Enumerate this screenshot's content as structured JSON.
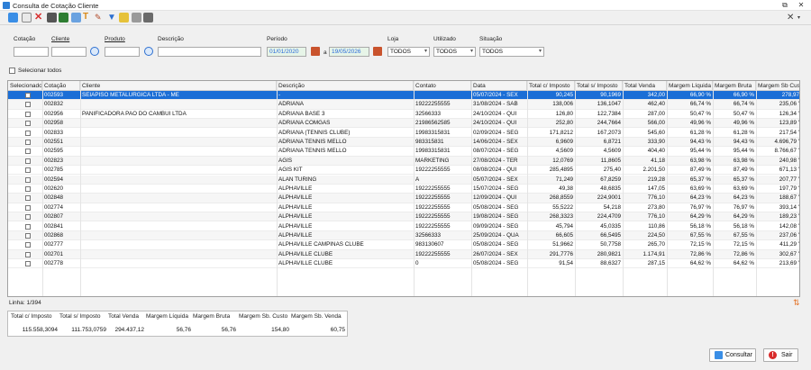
{
  "window": {
    "title": "Consulta de Cotação Cliente"
  },
  "filters": {
    "cotacao_label": "Cotação",
    "cliente_label": "Cliente",
    "produto_label": "Produto",
    "descricao_label": "Descrição",
    "periodo_label": "Período",
    "date_from": "01/01/2020",
    "a_label": "a",
    "date_to": "19/05/2026",
    "loja_label": "Loja",
    "loja_value": "TODOS",
    "utilizado_label": "Utilizado",
    "utilizado_value": "TODOS",
    "situacao_label": "Situação",
    "situacao_value": "TODOS",
    "select_all_label": "Selecionar todos"
  },
  "grid": {
    "headers": [
      "Selecionado",
      "Cotação",
      "Cliente",
      "Descrição",
      "Contato",
      "Data",
      "Total c/ Imposto",
      "Total s/ Imposto",
      "Total Venda",
      "Margem Líquida",
      "Margem Bruta",
      "Margem Sb Custo"
    ],
    "rows": [
      {
        "cot": "002593",
        "cli": "SEIAPISO METALURGICA LTDA - ME",
        "desc": "-",
        "cont": "",
        "data": "05/07/2024 - SEX",
        "tci": "90,245",
        "tsi": "90,1969",
        "tv": "342,00",
        "ml": "66,90 %",
        "mb": "66,90 %",
        "msc": "278,97"
      },
      {
        "cot": "002832",
        "cli": "",
        "desc": "ADRIANA",
        "cont": "19222255555",
        "data": "31/08/2024 - SAB",
        "tci": "138,006",
        "tsi": "136,1047",
        "tv": "462,40",
        "ml": "66,74 %",
        "mb": "66,74 %",
        "msc": "235,06 '"
      },
      {
        "cot": "002956",
        "cli": "PANIFICADORA PAO DO CAMBUI LTDA",
        "desc": "ADRIANA BASE 3",
        "cont": "32566333",
        "data": "24/10/2024 - QUI",
        "tci": "126,80",
        "tsi": "122,7384",
        "tv": "287,00",
        "ml": "50,47 %",
        "mb": "50,47 %",
        "msc": "126,34 '"
      },
      {
        "cot": "002958",
        "cli": "",
        "desc": "ADRIANA COMGAS",
        "cont": "21986562585",
        "data": "24/10/2024 - QUI",
        "tci": "252,80",
        "tsi": "244,7664",
        "tv": "566,00",
        "ml": "49,96 %",
        "mb": "49,96 %",
        "msc": "123,89 '"
      },
      {
        "cot": "002833",
        "cli": "",
        "desc": "ADRIANA (TENNIS CLUBE)",
        "cont": "19983315831",
        "data": "02/09/2024 - SEG",
        "tci": "171,8212",
        "tsi": "167,2073",
        "tv": "545,60",
        "ml": "61,28 %",
        "mb": "61,28 %",
        "msc": "217,54 '"
      },
      {
        "cot": "002551",
        "cli": "",
        "desc": "ADRIANA TENNIS MELLO",
        "cont": "983315831",
        "data": "14/06/2024 - SEX",
        "tci": "6,9609",
        "tsi": "6,8721",
        "tv": "333,90",
        "ml": "94,43 %",
        "mb": "94,43 %",
        "msc": "4.696,79 '"
      },
      {
        "cot": "002595",
        "cli": "",
        "desc": "ADRIANA TENNIS MELLO",
        "cont": "19983315831",
        "data": "08/07/2024 - SEG",
        "tci": "4,5609",
        "tsi": "4,5609",
        "tv": "404,40",
        "ml": "95,44 %",
        "mb": "95,44 %",
        "msc": "8.766,67 '"
      },
      {
        "cot": "002823",
        "cli": "",
        "desc": "AGIS",
        "cont": "MARKETING",
        "data": "27/08/2024 - TER",
        "tci": "12,0769",
        "tsi": "11,8605",
        "tv": "41,18",
        "ml": "63,98 %",
        "mb": "63,98 %",
        "msc": "240,98 '"
      },
      {
        "cot": "002785",
        "cli": "",
        "desc": "AGIS KIT",
        "cont": "19222255555",
        "data": "08/08/2024 - QUI",
        "tci": "285,4895",
        "tsi": "275,40",
        "tv": "2.201,50",
        "ml": "87,49 %",
        "mb": "87,49 %",
        "msc": "671,13 '"
      },
      {
        "cot": "002594",
        "cli": "",
        "desc": "ALAN TURING",
        "cont": "A",
        "data": "05/07/2024 - SEX",
        "tci": "71,249",
        "tsi": "67,8259",
        "tv": "219,28",
        "ml": "65,37 %",
        "mb": "65,37 %",
        "msc": "207,77 '"
      },
      {
        "cot": "002620",
        "cli": "",
        "desc": "ALPHAVILLE",
        "cont": "19222255555",
        "data": "15/07/2024 - SEG",
        "tci": "49,38",
        "tsi": "48,6835",
        "tv": "147,05",
        "ml": "63,69 %",
        "mb": "63,69 %",
        "msc": "197,79 '"
      },
      {
        "cot": "002848",
        "cli": "",
        "desc": "ALPHAVILLE",
        "cont": "19222255555",
        "data": "12/09/2024 - QUI",
        "tci": "268,8559",
        "tsi": "224,9001",
        "tv": "776,10",
        "ml": "64,23 %",
        "mb": "64,23 %",
        "msc": "188,67 '"
      },
      {
        "cot": "002774",
        "cli": "",
        "desc": "ALPHAVILLE",
        "cont": "19222255555",
        "data": "05/08/2024 - SEG",
        "tci": "55,5222",
        "tsi": "54,218",
        "tv": "273,80",
        "ml": "76,97 %",
        "mb": "76,97 %",
        "msc": "393,14 '"
      },
      {
        "cot": "002807",
        "cli": "",
        "desc": "ALPHAVILLE",
        "cont": "19222255555",
        "data": "19/08/2024 - SEG",
        "tci": "268,3323",
        "tsi": "224,4709",
        "tv": "776,10",
        "ml": "64,29 %",
        "mb": "64,29 %",
        "msc": "189,23 '"
      },
      {
        "cot": "002841",
        "cli": "",
        "desc": "ALPHAVILLE",
        "cont": "19222255555",
        "data": "09/09/2024 - SEG",
        "tci": "45,794",
        "tsi": "45,0335",
        "tv": "110,86",
        "ml": "56,18 %",
        "mb": "56,18 %",
        "msc": "142,08 '"
      },
      {
        "cot": "002868",
        "cli": "",
        "desc": "ALPHAVILLE",
        "cont": "32566333",
        "data": "25/09/2024 - QUA",
        "tci": "66,605",
        "tsi": "66,5495",
        "tv": "224,50",
        "ml": "67,55 %",
        "mb": "67,55 %",
        "msc": "237,06 '"
      },
      {
        "cot": "002777",
        "cli": "",
        "desc": "ALPHAVILLE CAMPINAS CLUBE",
        "cont": "983130607",
        "data": "05/08/2024 - SEG",
        "tci": "51,9662",
        "tsi": "50,7758",
        "tv": "265,70",
        "ml": "72,15 %",
        "mb": "72,15 %",
        "msc": "411,29 '"
      },
      {
        "cot": "002701",
        "cli": "",
        "desc": "ALPHAVILLE CLUBE",
        "cont": "19222255555",
        "data": "26/07/2024 - SEX",
        "tci": "291,7776",
        "tsi": "280,9821",
        "tv": "1.174,91",
        "ml": "72,86 %",
        "mb": "72,86 %",
        "msc": "302,67 '"
      },
      {
        "cot": "002778",
        "cli": "",
        "desc": "ALPHAVILLE CLUBE",
        "cont": "0",
        "data": "05/08/2024 - SEG",
        "tci": "91,54",
        "tsi": "88,6327",
        "tv": "287,15",
        "ml": "64,62 %",
        "mb": "64,62 %",
        "msc": "213,69 '"
      }
    ]
  },
  "status": {
    "line_text": "Linha: 1/394"
  },
  "totals": {
    "headers": [
      "Total c/ Imposto",
      "Total s/ Imposto",
      "Total Venda",
      "Margem Líquida",
      "Margem Bruta",
      "Margem Sb. Custo",
      "Margem Sb. Venda"
    ],
    "values": [
      "115.558,3094",
      "111.753,0759",
      "294.437,12",
      "56,76",
      "56,76",
      "154,80",
      "60,75"
    ]
  },
  "buttons": {
    "consultar": "Consultar",
    "sair": "Sair"
  }
}
